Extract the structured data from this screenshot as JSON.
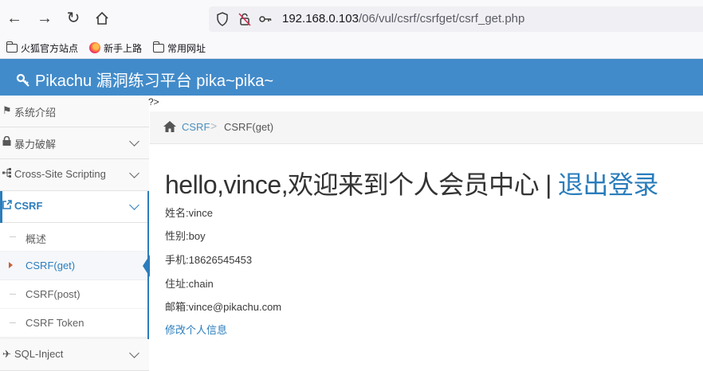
{
  "browser": {
    "url_host": "192.168.0.103",
    "url_path": "/06/vul/csrf/csrfget/csrf_get.php"
  },
  "bookmarks": [
    {
      "label": "火狐官方站点",
      "icon": "folder-icon"
    },
    {
      "label": "新手上路",
      "icon": "firefox-icon"
    },
    {
      "label": "常用网址",
      "icon": "folder-icon"
    }
  ],
  "header": {
    "title": "Pikachu 漏洞练习平台 pika~pika~"
  },
  "sidebar": {
    "items": [
      {
        "label": "系统介绍",
        "icon": "tags-icon"
      },
      {
        "label": "暴力破解",
        "icon": "lock-icon"
      },
      {
        "label": "Cross-Site Scripting",
        "icon": "sitemap-icon"
      },
      {
        "label": "CSRF",
        "icon": "share-icon"
      },
      {
        "label": "SQL-Inject",
        "icon": "plane-icon"
      }
    ],
    "csrf_sub": [
      "概述",
      "CSRF(get)",
      "CSRF(post)",
      "CSRF Token"
    ]
  },
  "main": {
    "stray_text": "?>",
    "breadcrumb": {
      "link": "CSRF",
      "separator": ">",
      "current": "CSRF(get)"
    },
    "title": "hello,vince,欢迎来到个人会员中心",
    "title_sep": "|",
    "logout": "退出登录",
    "info": {
      "name": "姓名:vince",
      "sex": "性别:boy",
      "phone": "手机:18626545453",
      "address": "住址:chain",
      "email": "邮箱:vince@pikachu.com"
    },
    "edit_link": "修改个人信息"
  },
  "colors": {
    "header_bg": "#428bca",
    "accent": "#2b7dbc"
  }
}
